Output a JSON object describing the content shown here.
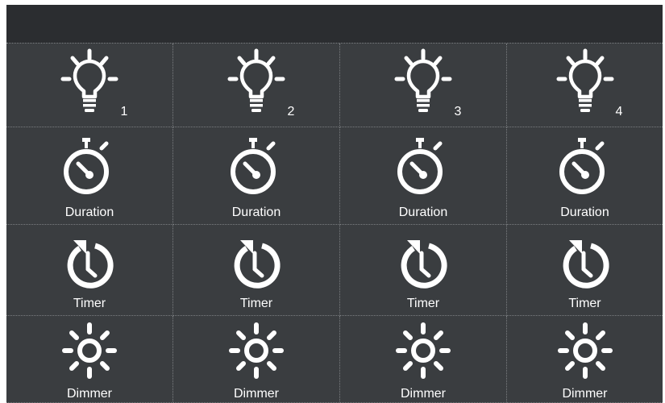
{
  "header": {
    "title": ""
  },
  "colors": {
    "background": "#3a3d40",
    "header": "#2b2d30",
    "icon": "#ffffff",
    "divider": "#7b7e81"
  },
  "rows": [
    {
      "type": "light",
      "icon": "lightbulb-icon",
      "cells": [
        {
          "number": "1"
        },
        {
          "number": "2"
        },
        {
          "number": "3"
        },
        {
          "number": "4"
        }
      ]
    },
    {
      "type": "duration",
      "icon": "stopwatch-icon",
      "cells": [
        {
          "label": "Duration"
        },
        {
          "label": "Duration"
        },
        {
          "label": "Duration"
        },
        {
          "label": "Duration"
        }
      ]
    },
    {
      "type": "timer",
      "icon": "timer-icon",
      "cells": [
        {
          "label": "Timer"
        },
        {
          "label": "Timer"
        },
        {
          "label": "Timer"
        },
        {
          "label": "Timer"
        }
      ]
    },
    {
      "type": "dimmer",
      "icon": "brightness-icon",
      "cells": [
        {
          "label": "Dimmer"
        },
        {
          "label": "Dimmer"
        },
        {
          "label": "Dimmer"
        },
        {
          "label": "Dimmer"
        }
      ]
    }
  ]
}
